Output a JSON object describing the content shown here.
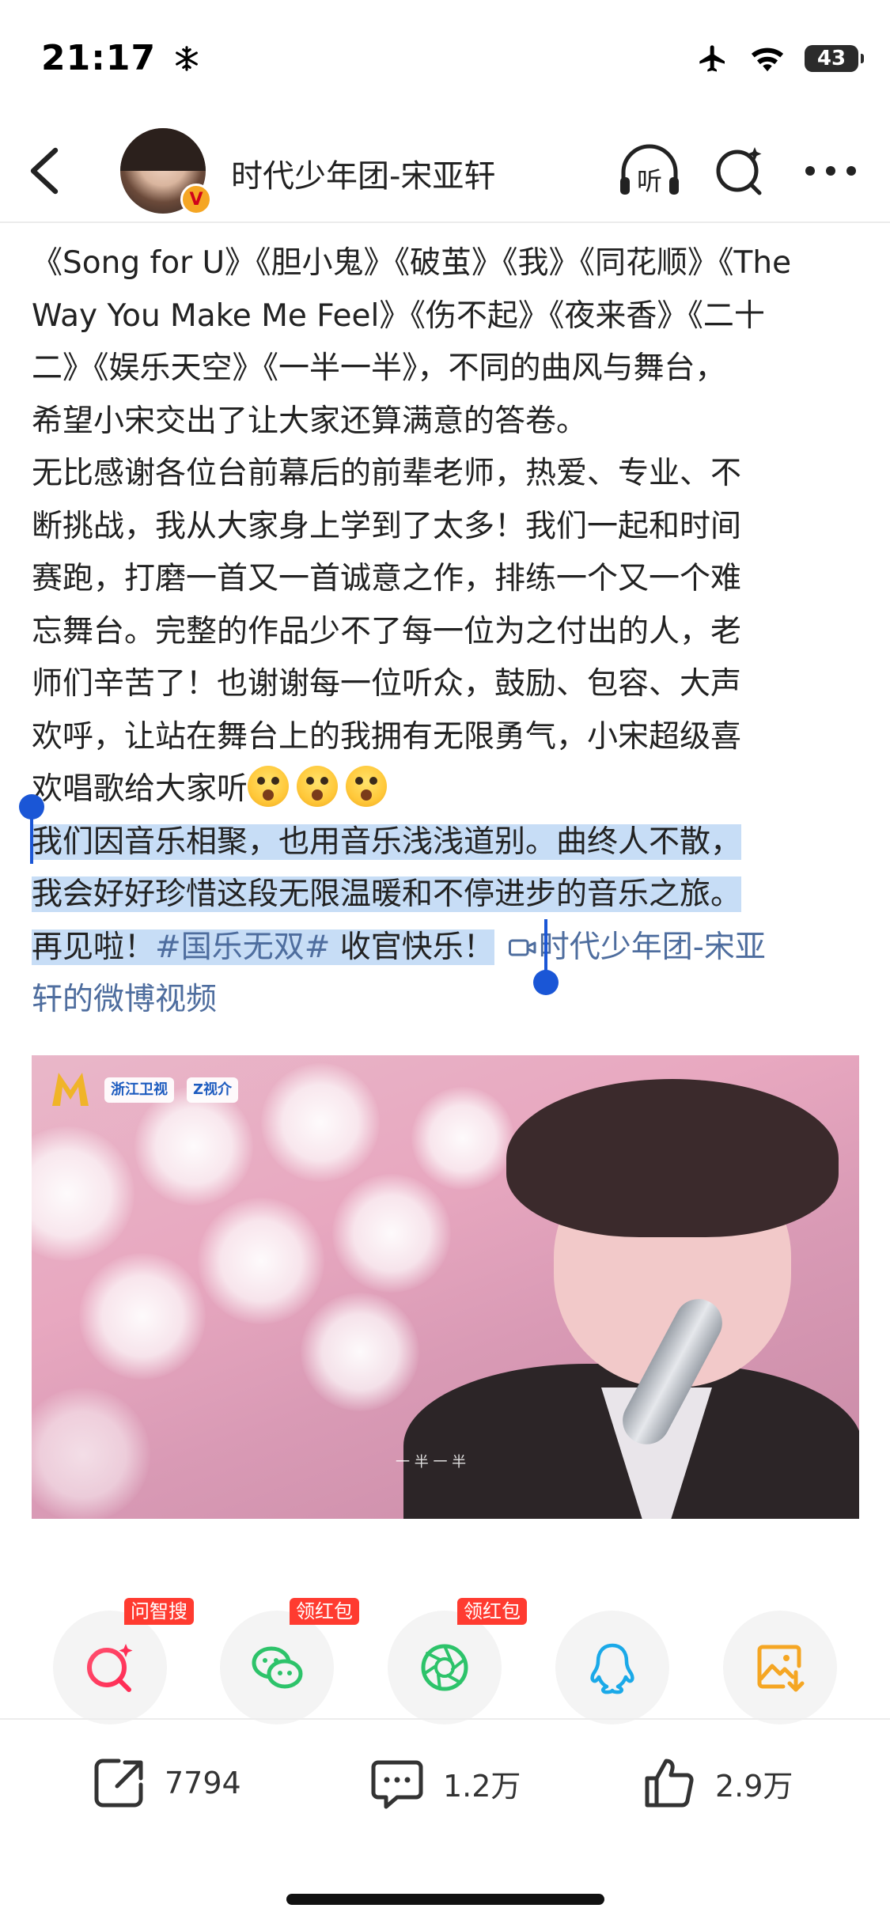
{
  "status_bar": {
    "time": "21:17",
    "battery": "43",
    "icons": [
      "snowflake-icon",
      "airplane-icon",
      "wifi-icon",
      "battery-icon"
    ]
  },
  "nav": {
    "title": "时代少年团-宋亚轩",
    "verified_badge": "V",
    "listen_label": "听",
    "icons": [
      "back-icon",
      "listen-icon",
      "search-icon",
      "more-icon"
    ]
  },
  "post": {
    "lines": [
      "《Song for U》《胆小鬼》《破茧》《我》《同花顺》《The",
      "Way You Make Me Feel》《伤不起》《夜来香》《二十",
      "二》《娱乐天空》《一半一半》，不同的曲风与舞台，",
      "希望小宋交出了让大家还算满意的答卷。",
      "无比感谢各位台前幕后的前辈老师，热爱、专业、不",
      "断挑战，我从大家身上学到了太多！我们一起和时间",
      "赛跑，打磨一首又一首诚意之作，排练一个又一个难",
      "忘舞台。完整的作品少不了每一位为之付出的人，老",
      "师们辛苦了！也谢谢每一位听众，鼓励、包容、大声",
      "欢呼，让站在舞台上的我拥有无限勇气，小宋超级喜"
    ],
    "line_11": "欢唱歌给大家听",
    "selected_line_1": "我们因音乐相聚，也用音乐浅浅道别。曲终人不散，",
    "selected_line_2": "我会好好珍惜这段无限温暖和不停进步的音乐之旅。",
    "selected_line_3a": "再见啦！",
    "hashtag": "#国乐无双#",
    "selected_line_3b": " 收官快乐！",
    "video_link_a": "时代少年团-宋亚",
    "video_link_b": "轩的微博视频"
  },
  "video": {
    "caption": "一 半 一 半",
    "badges": [
      "浙江卫视",
      "Z视介"
    ]
  },
  "share": {
    "tags": [
      "问智搜",
      "领红包",
      "领红包"
    ],
    "icons": [
      "ai-search-icon",
      "wechat-icon",
      "moments-icon",
      "qq-icon",
      "save-image-icon"
    ]
  },
  "actions": {
    "repost": "7794",
    "comment": "1.2万",
    "like": "2.9万"
  },
  "colors": {
    "link": "#4e6d9e",
    "selection": "#c7ddf6",
    "handle": "#1a56d6",
    "tag_red": "#ff3b30"
  }
}
